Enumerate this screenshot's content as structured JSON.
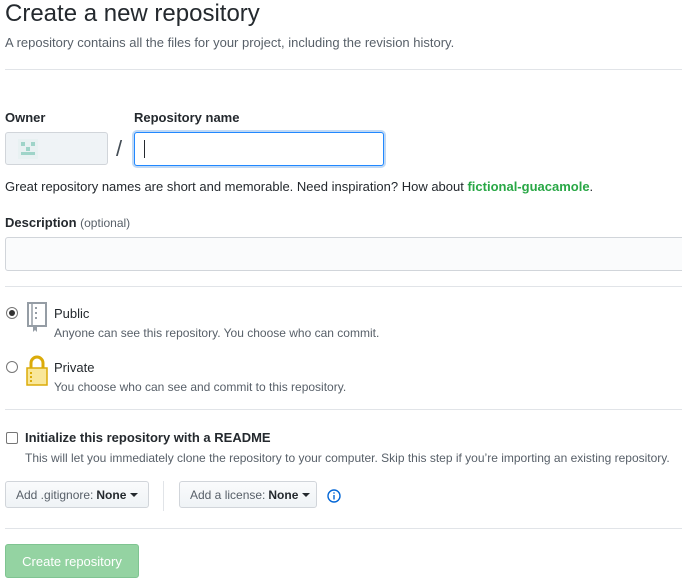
{
  "header": {
    "title": "Create a new repository",
    "subtitle": "A repository contains all the files for your project, including the revision history."
  },
  "owner": {
    "label": "Owner",
    "avatar_icon": "identicon-avatar"
  },
  "separator": "/",
  "repo_name": {
    "label": "Repository name",
    "value": ""
  },
  "hint": {
    "prefix": "Great repository names are short and memorable. Need inspiration? How about ",
    "suggestion": "fictional-guacamole",
    "suffix": "."
  },
  "description": {
    "label": "Description",
    "optional": "(optional)",
    "value": ""
  },
  "visibility": {
    "public": {
      "title": "Public",
      "desc": "Anyone can see this repository. You choose who can commit.",
      "checked": true,
      "icon": "repo-book-icon"
    },
    "private": {
      "title": "Private",
      "desc": "You choose who can see and commit to this repository.",
      "checked": false,
      "icon": "lock-icon"
    }
  },
  "readme": {
    "title": "Initialize this repository with a README",
    "desc": "This will let you immediately clone the repository to your computer. Skip this step if you’re importing an existing repository.",
    "checked": false
  },
  "gitignore": {
    "label": "Add .gitignore:",
    "value": "None"
  },
  "license": {
    "label": "Add a license:",
    "value": "None"
  },
  "info_icon": "info-icon",
  "submit": {
    "label": "Create repository"
  },
  "colors": {
    "accent": "#2188ff",
    "suggestion": "#28a745",
    "create_button": "#94d3a2"
  }
}
